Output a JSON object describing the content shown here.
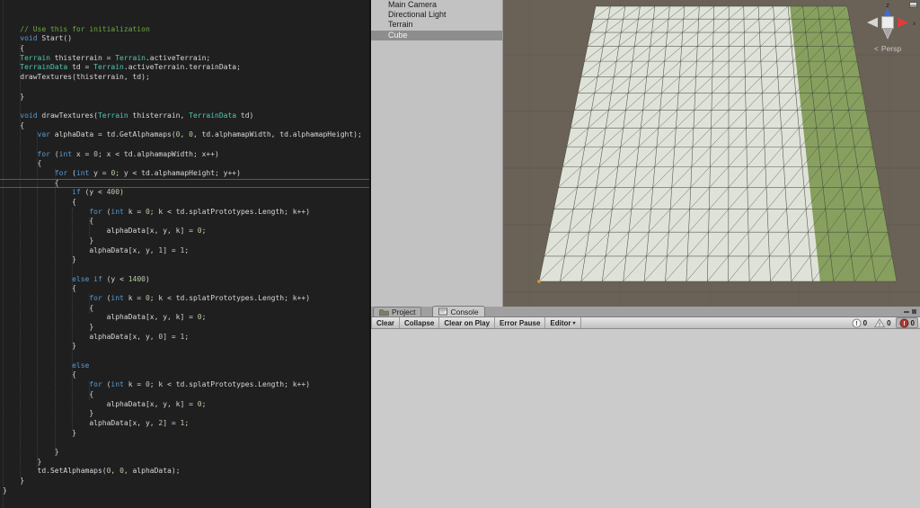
{
  "code_editor": {
    "colors": {
      "background": "#1f1f1f",
      "comment": "#6fa948",
      "keyword": "#559cd6",
      "type": "#4ec9b0",
      "number": "#b5cea8",
      "plain": "#d8d8d8",
      "indent_guide": "#3d3d3d",
      "current_line_border": "#5a5a5a"
    },
    "lines": [
      {
        "s": []
      },
      {
        "s": [
          [
            "c",
            "    // Use this for initialization"
          ]
        ]
      },
      {
        "s": [
          [
            "k",
            "    void"
          ],
          [
            "p",
            " Start()"
          ]
        ]
      },
      {
        "s": [
          [
            "p",
            "    {"
          ]
        ]
      },
      {
        "s": [
          [
            "ty",
            "    Terrain"
          ],
          [
            "p",
            " thisterrain = "
          ],
          [
            "ty",
            "Terrain"
          ],
          [
            "p",
            ".activeTerrain;"
          ]
        ]
      },
      {
        "s": [
          [
            "ty",
            "    TerrainData"
          ],
          [
            "p",
            " td = "
          ],
          [
            "ty",
            "Terrain"
          ],
          [
            "p",
            ".activeTerrain.terrainData;"
          ]
        ]
      },
      {
        "s": [
          [
            "p",
            "    drawTextures(thisterrain, td);"
          ]
        ]
      },
      {
        "s": []
      },
      {
        "s": [
          [
            "p",
            "    }"
          ]
        ]
      },
      {
        "s": []
      },
      {
        "s": [
          [
            "k",
            "    void"
          ],
          [
            "p",
            " drawTextures("
          ],
          [
            "ty",
            "Terrain"
          ],
          [
            "p",
            " thisterrain, "
          ],
          [
            "ty",
            "TerrainData"
          ],
          [
            "p",
            " td)"
          ]
        ]
      },
      {
        "s": [
          [
            "p",
            "    {"
          ]
        ]
      },
      {
        "s": [
          [
            "k",
            "        var"
          ],
          [
            "p",
            " alphaData = td.GetAlphamaps("
          ],
          [
            "n",
            "0"
          ],
          [
            "p",
            ", "
          ],
          [
            "n",
            "0"
          ],
          [
            "p",
            ", td.alphamapWidth, td.alphamapHeight);"
          ]
        ]
      },
      {
        "s": []
      },
      {
        "s": [
          [
            "k",
            "        for"
          ],
          [
            "p",
            " ("
          ],
          [
            "k",
            "int"
          ],
          [
            "p",
            " x = "
          ],
          [
            "n",
            "0"
          ],
          [
            "p",
            "; x < td.alphamapWidth; x++)"
          ]
        ]
      },
      {
        "s": [
          [
            "p",
            "        {"
          ]
        ]
      },
      {
        "s": [
          [
            "k",
            "            for"
          ],
          [
            "p",
            " ("
          ],
          [
            "k",
            "int"
          ],
          [
            "p",
            " y = "
          ],
          [
            "n",
            "0"
          ],
          [
            "p",
            "; y < td.alphamapHeight; y++)"
          ]
        ]
      },
      {
        "s": [
          [
            "p",
            "            {"
          ]
        ],
        "current": true
      },
      {
        "s": [
          [
            "k",
            "                if"
          ],
          [
            "p",
            " (y < "
          ],
          [
            "n",
            "400"
          ],
          [
            "p",
            ")"
          ]
        ]
      },
      {
        "s": [
          [
            "p",
            "                {"
          ]
        ]
      },
      {
        "s": [
          [
            "k",
            "                    for"
          ],
          [
            "p",
            " ("
          ],
          [
            "k",
            "int"
          ],
          [
            "p",
            " k = "
          ],
          [
            "n",
            "0"
          ],
          [
            "p",
            "; k < td.splatPrototypes.Length; k++)"
          ]
        ]
      },
      {
        "s": [
          [
            "p",
            "                    {"
          ]
        ]
      },
      {
        "s": [
          [
            "p",
            "                        alphaData[x, y, k] = "
          ],
          [
            "n",
            "0"
          ],
          [
            "p",
            ";"
          ]
        ]
      },
      {
        "s": [
          [
            "p",
            "                    }"
          ]
        ]
      },
      {
        "s": [
          [
            "p",
            "                    alphaData[x, y, "
          ],
          [
            "n",
            "1"
          ],
          [
            "p",
            "] = "
          ],
          [
            "n",
            "1"
          ],
          [
            "p",
            ";"
          ]
        ]
      },
      {
        "s": [
          [
            "p",
            "                }"
          ]
        ]
      },
      {
        "s": []
      },
      {
        "s": [
          [
            "k",
            "                else"
          ],
          [
            "p",
            " "
          ],
          [
            "k",
            "if"
          ],
          [
            "p",
            " (y < "
          ],
          [
            "n",
            "1400"
          ],
          [
            "p",
            ")"
          ]
        ]
      },
      {
        "s": [
          [
            "p",
            "                {"
          ]
        ]
      },
      {
        "s": [
          [
            "k",
            "                    for"
          ],
          [
            "p",
            " ("
          ],
          [
            "k",
            "int"
          ],
          [
            "p",
            " k = "
          ],
          [
            "n",
            "0"
          ],
          [
            "p",
            "; k < td.splatPrototypes.Length; k++)"
          ]
        ]
      },
      {
        "s": [
          [
            "p",
            "                    {"
          ]
        ]
      },
      {
        "s": [
          [
            "p",
            "                        alphaData[x, y, k] = "
          ],
          [
            "n",
            "0"
          ],
          [
            "p",
            ";"
          ]
        ]
      },
      {
        "s": [
          [
            "p",
            "                    }"
          ]
        ]
      },
      {
        "s": [
          [
            "p",
            "                    alphaData[x, y, "
          ],
          [
            "n",
            "0"
          ],
          [
            "p",
            "] = "
          ],
          [
            "n",
            "1"
          ],
          [
            "p",
            ";"
          ]
        ]
      },
      {
        "s": [
          [
            "p",
            "                }"
          ]
        ]
      },
      {
        "s": []
      },
      {
        "s": [
          [
            "k",
            "                else"
          ]
        ]
      },
      {
        "s": [
          [
            "p",
            "                {"
          ]
        ]
      },
      {
        "s": [
          [
            "k",
            "                    for"
          ],
          [
            "p",
            " ("
          ],
          [
            "k",
            "int"
          ],
          [
            "p",
            " k = "
          ],
          [
            "n",
            "0"
          ],
          [
            "p",
            "; k < td.splatPrototypes.Length; k++)"
          ]
        ]
      },
      {
        "s": [
          [
            "p",
            "                    {"
          ]
        ]
      },
      {
        "s": [
          [
            "p",
            "                        alphaData[x, y, k] = "
          ],
          [
            "n",
            "0"
          ],
          [
            "p",
            ";"
          ]
        ]
      },
      {
        "s": [
          [
            "p",
            "                    }"
          ]
        ]
      },
      {
        "s": [
          [
            "p",
            "                    alphaData[x, y, "
          ],
          [
            "n",
            "2"
          ],
          [
            "p",
            "] = "
          ],
          [
            "n",
            "1"
          ],
          [
            "p",
            ";"
          ]
        ]
      },
      {
        "s": [
          [
            "p",
            "                }"
          ]
        ]
      },
      {
        "s": []
      },
      {
        "s": [
          [
            "p",
            "            }"
          ]
        ]
      },
      {
        "s": [
          [
            "p",
            "        }"
          ]
        ]
      },
      {
        "s": [
          [
            "p",
            "        td.SetAlphamaps("
          ],
          [
            "n",
            "0"
          ],
          [
            "p",
            ", "
          ],
          [
            "n",
            "0"
          ],
          [
            "p",
            ", alphaData);"
          ]
        ]
      },
      {
        "s": [
          [
            "p",
            "    }"
          ]
        ]
      },
      {
        "s": [
          [
            "p",
            "}"
          ]
        ]
      }
    ]
  },
  "hierarchy": {
    "colors": {
      "background": "#c2c2c2",
      "selected_row": "#8d8d8d"
    },
    "items": [
      {
        "label": "Main Camera",
        "selected": false
      },
      {
        "label": "Directional Light",
        "selected": false
      },
      {
        "label": "Terrain",
        "selected": false
      },
      {
        "label": "Cube",
        "selected": true
      }
    ]
  },
  "scene": {
    "colors": {
      "background": "#6a6257",
      "terrain_light": "#dfe2d8",
      "terrain_green": "#88a05f",
      "grid_line": "#40453a",
      "origin_dot": "#e2952f"
    },
    "gizmo": {
      "up_axis_label": "z",
      "right_axis_label": "x",
      "up_axis_color": "#3d6ce0",
      "right_axis_color": "#dd3d3b",
      "mode_icon": "<",
      "mode_label": "Persp"
    }
  },
  "console": {
    "tabs": [
      {
        "label": "Project",
        "icon": "folder-icon",
        "active": false
      },
      {
        "label": "Console",
        "icon": "console-icon",
        "active": true
      }
    ],
    "toolbar": {
      "buttons": [
        {
          "label": "Clear"
        },
        {
          "label": "Collapse"
        },
        {
          "label": "Clear on Play"
        },
        {
          "label": "Error Pause"
        },
        {
          "label": "Editor",
          "dropdown": true
        }
      ]
    },
    "badges": [
      {
        "type": "info",
        "count": "0",
        "active": false
      },
      {
        "type": "warning",
        "count": "0",
        "active": false
      },
      {
        "type": "error",
        "count": "0",
        "active": true
      }
    ]
  }
}
